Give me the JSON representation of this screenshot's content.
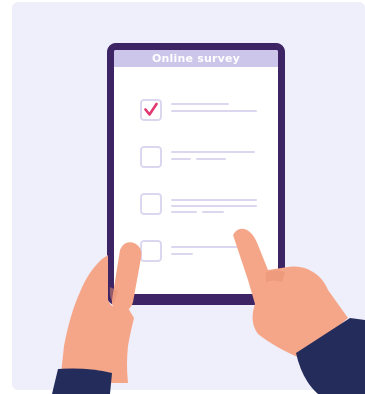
{
  "survey": {
    "title": "Online survey"
  },
  "checklist": {
    "items": [
      {
        "checked": true
      },
      {
        "checked": false
      },
      {
        "checked": false
      },
      {
        "checked": false
      }
    ]
  },
  "colors": {
    "background_panel": "#efeefb",
    "tablet_frame": "#3d2565",
    "header_bar": "#cbc6ea",
    "checkbox_border": "#dcd7ef",
    "checkmark": "#e0386f",
    "text_line": "#dcd7ef",
    "skin": "#f6a688",
    "skin_shadow": "#e88f72",
    "sleeve": "#232c5b"
  },
  "icons": {
    "checkmark": "checkmark-icon"
  }
}
